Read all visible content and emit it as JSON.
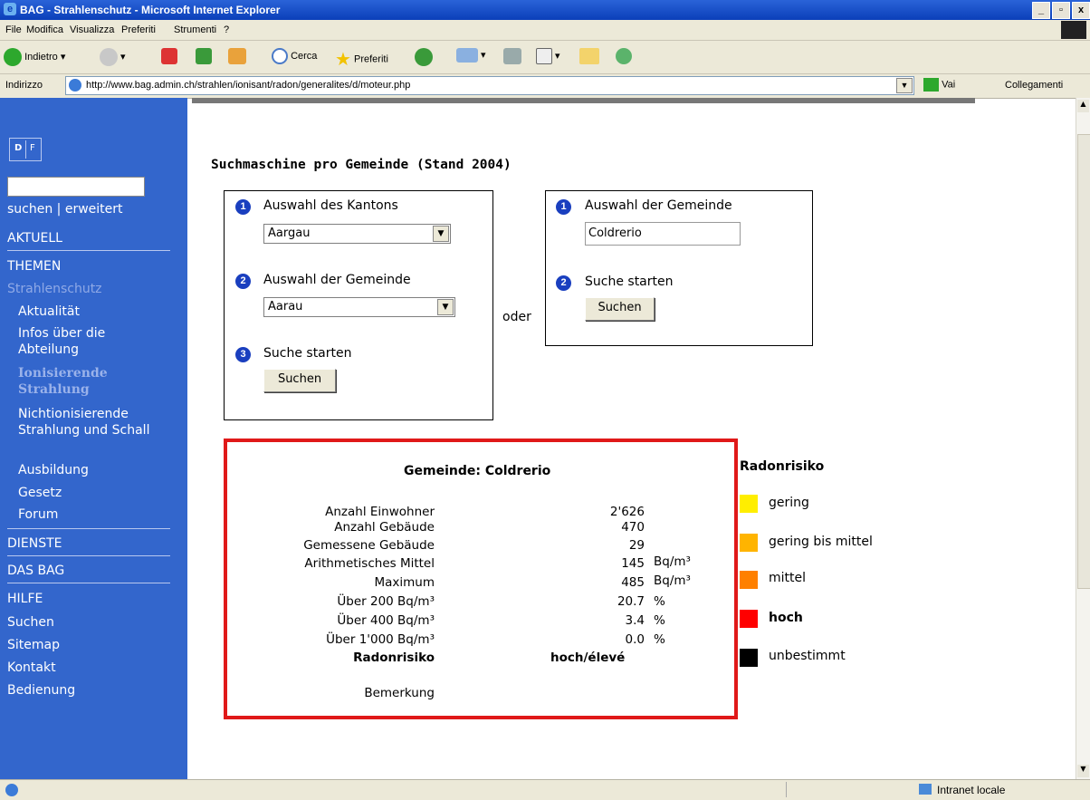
{
  "window": {
    "title": "BAG - Strahlenschutz - Microsoft Internet Explorer"
  },
  "menu": [
    "File",
    "Modifica",
    "Visualizza",
    "Preferiti",
    "Strumenti",
    "?"
  ],
  "toolbar": {
    "back": "Indietro",
    "search": "Cerca",
    "favorites": "Preferiti"
  },
  "address": {
    "label": "Indirizzo",
    "url": "http://www.bag.admin.ch/strahlen/ionisant/radon/generalites/d/moteur.php",
    "go": "Vai",
    "links": "Collegamenti"
  },
  "sidebar": {
    "lang": [
      "D",
      "F"
    ],
    "search_links": "suchen | erweitert",
    "aktuell": "AKTUELL",
    "themen": "THEMEN",
    "strahlenschutz": "Strahlenschutz",
    "sub": [
      "Aktualität",
      "Infos über die Abteilung",
      "Ionisierende Strahlung",
      "Nichtionisierende Strahlung und Schall",
      "Ausbildung",
      "Gesetz",
      "Forum"
    ],
    "dienste": "DIENSTE",
    "dasbag": "DAS BAG",
    "hilfe": "HILFE",
    "help_items": [
      "Suchen",
      "Sitemap",
      "Kontakt",
      "Bedienung"
    ]
  },
  "main": {
    "heading": "Suchmaschine pro Gemeinde (Stand 2004)",
    "left": {
      "step1": "Auswahl des Kantons",
      "kanton": "Aargau",
      "step2": "Auswahl der Gemeinde",
      "gemeinde": "Aarau",
      "step3": "Suche starten",
      "button": "Suchen"
    },
    "oder": "oder",
    "right": {
      "step1": "Auswahl der Gemeinde",
      "input": "Coldrerio",
      "step2": "Suche starten",
      "button": "Suchen"
    },
    "result": {
      "title": "Gemeinde: Coldrerio",
      "rows": [
        {
          "label": "Anzahl Einwohner",
          "value": "2'626",
          "unit": ""
        },
        {
          "label": "Anzahl Gebäude",
          "value": "470",
          "unit": ""
        },
        {
          "label": "Gemessene Gebäude",
          "value": "29",
          "unit": ""
        },
        {
          "label": "Arithmetisches Mittel",
          "value": "145",
          "unit": "Bq/m³"
        },
        {
          "label": "Maximum",
          "value": "485",
          "unit": "Bq/m³"
        },
        {
          "label": "Über 200 Bq/m³",
          "value": "20.7",
          "unit": "%"
        },
        {
          "label": "Über 400 Bq/m³",
          "value": "3.4",
          "unit": "%"
        },
        {
          "label": "Über 1'000 Bq/m³",
          "value": "0.0",
          "unit": "%"
        }
      ],
      "risk_label": "Radonrisiko",
      "risk_value": "hoch/élevé",
      "remark_label": "Bemerkung"
    },
    "legend": {
      "title": "Radonrisiko",
      "items": [
        {
          "label": "gering",
          "color": "#ffee00"
        },
        {
          "label": "gering bis mittel",
          "color": "#ffb400"
        },
        {
          "label": "mittel",
          "color": "#ff8000"
        },
        {
          "label": "hoch",
          "color": "#ff0000"
        },
        {
          "label": "unbestimmt",
          "color": "#000000"
        }
      ]
    }
  },
  "status": {
    "zone": "Intranet locale"
  }
}
